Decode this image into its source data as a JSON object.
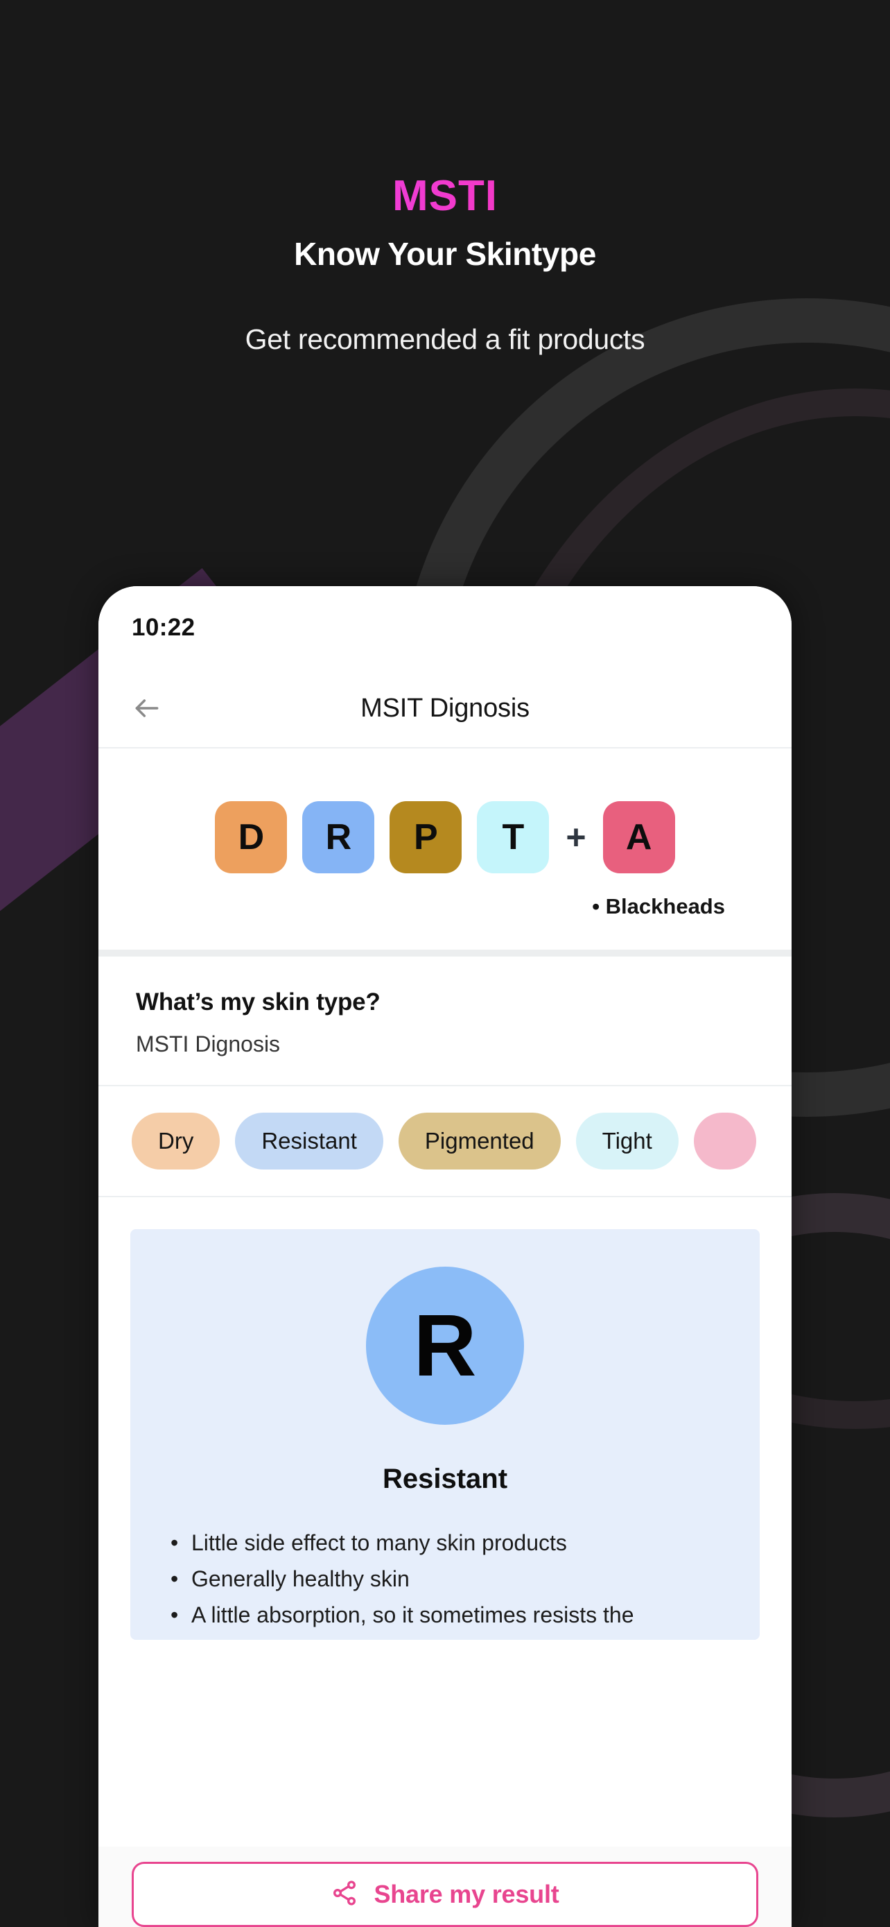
{
  "promo": {
    "logo": "MSTI",
    "title": "Know Your Skintype",
    "tagline": "Get recommended a fit products",
    "logo_gradient_from": "#e04bfb",
    "logo_gradient_to": "#ff2b92",
    "background_color": "#191919"
  },
  "phone": {
    "status_bar": {
      "time": "10:22"
    },
    "nav": {
      "back_icon": "arrow-left-icon",
      "title": "MSIT Dignosis"
    },
    "code_tiles": {
      "tiles": [
        {
          "letter": "D",
          "color": "#eda05e"
        },
        {
          "letter": "R",
          "color": "#85b4f5"
        },
        {
          "letter": "P",
          "color": "#b5891f"
        },
        {
          "letter": "T",
          "color": "#c5f5fb"
        }
      ],
      "plus": "+",
      "extra_tile": {
        "letter": "A",
        "color": "#e8607e"
      },
      "note": "• Blackheads"
    },
    "question": {
      "title": "What’s my skin type?",
      "subtitle": "MSTI Dignosis"
    },
    "chips": [
      {
        "label": "Dry",
        "color": "#f5cda8"
      },
      {
        "label": "Resistant",
        "color": "#c3d9f5"
      },
      {
        "label": "Pigmented",
        "color": "#dbc38b"
      },
      {
        "label": "Tight",
        "color": "#d8f3f8"
      },
      {
        "label": "",
        "color": "#f5b9cb"
      }
    ],
    "result_card": {
      "badge_letter": "R",
      "badge_color": "#8bbcf7",
      "card_color": "#e6eefb",
      "name": "Resistant",
      "bullets": [
        "Little side effect to many skin products",
        "Generally healthy skin",
        "A little absorption, so it sometimes resists the"
      ]
    },
    "share": {
      "icon": "share-icon",
      "label": "Share my result",
      "accent_color": "#e8458f"
    }
  }
}
